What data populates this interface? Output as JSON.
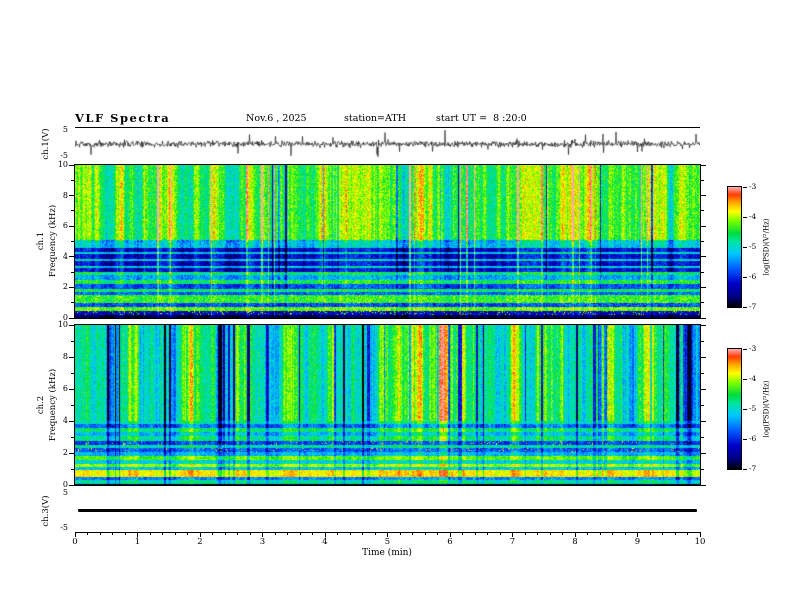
{
  "header": {
    "title": "VLF Spectra",
    "date": "Nov.6 , 2025",
    "station": "station=ATH",
    "start_ut": "start UT =  8 :20:0"
  },
  "xaxis": {
    "label": "Time (min)",
    "range": [
      0,
      10
    ],
    "ticks": [
      "0",
      "1",
      "2",
      "3",
      "4",
      "5",
      "6",
      "7",
      "8",
      "9",
      "10"
    ]
  },
  "panels": {
    "ch1_wave": {
      "ylabel": "ch.1(V)",
      "ylim": [
        -5,
        5
      ],
      "yticks": [
        "5",
        "-5"
      ]
    },
    "ch1_spec": {
      "ylabel_line1": "ch.1",
      "ylabel_line2": "Frequency (kHz)",
      "ylim": [
        0,
        10
      ],
      "yticks": [
        "10",
        "8",
        "6",
        "4",
        "2",
        "0"
      ]
    },
    "ch2_spec": {
      "ylabel_line1": "ch.2",
      "ylabel_line2": "Frequency (kHz)",
      "ylim": [
        0,
        10
      ],
      "yticks": [
        "10",
        "8",
        "6",
        "4",
        "2",
        "0"
      ]
    },
    "ch3_wave": {
      "ylabel": "ch.3(V)",
      "ylim": [
        -5,
        5
      ],
      "yticks": [
        "5",
        "-5"
      ]
    }
  },
  "colorbars": [
    {
      "label": "log(PSD)(V²/Hz)",
      "ticks": [
        "-3",
        "-4",
        "-5",
        "-6",
        "-7"
      ],
      "range": [
        -3,
        -7
      ]
    },
    {
      "label": "log(PSD)(V²/Hz)",
      "ticks": [
        "-3",
        "-4",
        "-5",
        "-6",
        "-7"
      ],
      "range": [
        -3,
        -7
      ]
    }
  ],
  "chart_data": [
    {
      "type": "line",
      "panel": "ch.1 waveform",
      "ylabel": "ch.1(V)",
      "ylim": [
        -5,
        5
      ],
      "x_range_min": [
        0,
        10
      ],
      "description": "Dense broadband noise trace centered on 0 V with impulsive spikes reaching roughly ±4 V throughout the 10-minute record"
    },
    {
      "type": "heatmap",
      "panel": "ch.1 spectrogram",
      "ylabel": "ch.1 Frequency (kHz)",
      "ylim": [
        0,
        10
      ],
      "x_range_min": [
        0,
        10
      ],
      "zlabel": "log(PSD)(V²/Hz)",
      "zlim": [
        -7,
        -3
      ],
      "description": "Green/yellow broadband power above 5 kHz with frequent red vertical sferic streaks, dark blue quiet band 3-4.6 kHz with faint horizontal tones, bright green bands near 1-1.6 and 2.3-3 kHz, bright narrow line near 0.6-0.8 kHz, near-black band below 0.25 kHz",
      "colormap": {
        "stops": [
          0,
          0.1,
          0.2,
          0.32,
          0.45,
          0.55,
          0.62,
          0.72,
          0.8,
          0.88,
          0.94,
          1.0
        ],
        "colors": [
          "#000000",
          "#00008c",
          "#0000c8",
          "#005aff",
          "#00c8ff",
          "#00e6a0",
          "#00dc3c",
          "#78ff00",
          "#ffff00",
          "#ffa000",
          "#ff3c00",
          "#ffaaaa"
        ]
      }
    },
    {
      "type": "heatmap",
      "panel": "ch.2 spectrogram",
      "ylabel": "ch.2 Frequency (kHz)",
      "ylim": [
        0,
        10
      ],
      "x_range_min": [
        0,
        10
      ],
      "zlabel": "log(PSD)(V²/Hz)",
      "zlim": [
        -7,
        -3
      ],
      "description": "Mostly green broadband field above 4 kHz crossed by many dark-blue vertical dropout streaks; below 4 kHz strong horizontal banding: yellow lines near 1.3 and 1.7 kHz, dark rows with red speckles near 2.2 and 2.7 kHz, intense red/orange band 0.5-0.95 kHz, black row at the bottom edge",
      "colormap": {
        "stops": [
          0,
          0.1,
          0.2,
          0.32,
          0.45,
          0.55,
          0.62,
          0.72,
          0.8,
          0.88,
          0.94,
          1.0
        ],
        "colors": [
          "#000000",
          "#00008c",
          "#0000c8",
          "#005aff",
          "#00c8ff",
          "#00e6a0",
          "#00dc3c",
          "#78ff00",
          "#ffff00",
          "#ffa000",
          "#ff3c00",
          "#ffaaaa"
        ]
      }
    },
    {
      "type": "line",
      "panel": "ch.3 waveform",
      "ylabel": "ch.3(V)",
      "ylim": [
        -5,
        5
      ],
      "x_range_min": [
        0,
        10
      ],
      "description": "Flat thick black trace at 0 V for the whole record (channel inactive)"
    }
  ]
}
